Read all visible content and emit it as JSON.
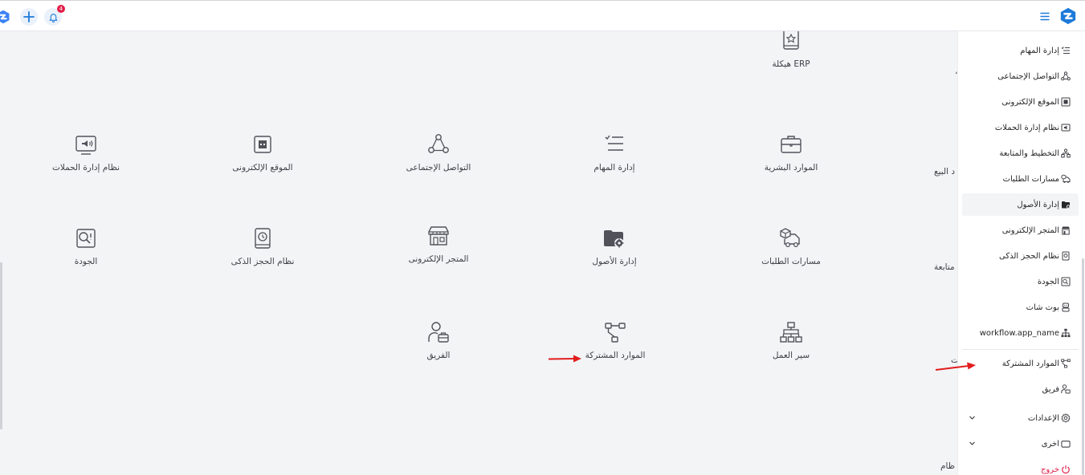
{
  "header": {
    "notifications_count": "4"
  },
  "main": {
    "top_tile": {
      "label": "هيكلة ERP"
    },
    "tiles": [
      {
        "label": "نظام إدارة الحملات",
        "icon": "megaphone-icon"
      },
      {
        "label": "الموقع الإلكترونى",
        "icon": "website-icon"
      },
      {
        "label": "التواصل الإجتماعى",
        "icon": "social-icon"
      },
      {
        "label": "إدارة المهام",
        "icon": "tasks-icon"
      },
      {
        "label": "الموارد البشرية",
        "icon": "briefcase-icon"
      },
      {
        "label": "الجودة",
        "icon": "quality-icon"
      },
      {
        "label": "نظام الحجز الذكى",
        "icon": "booking-icon"
      },
      {
        "label": "المتجر الإلكترونى",
        "icon": "store-icon"
      },
      {
        "label": "إدارة الأصول",
        "icon": "assets-icon"
      },
      {
        "label": "مسارات الطلبات",
        "icon": "delivery-icon"
      },
      {
        "label": "الفريق",
        "icon": "team-icon"
      },
      {
        "label": "الموارد المشتركة",
        "icon": "shared-icon"
      },
      {
        "label": "سير العمل",
        "icon": "workflow-icon"
      }
    ],
    "fragments": {
      "sales": "د البيع",
      "followup": "متابعة",
      "partial": "ت",
      "system": "ظام"
    }
  },
  "sidebar": {
    "items": [
      {
        "label": "إدارة المهام",
        "icon": "tasks-icon"
      },
      {
        "label": "التواصل الإجتماعى",
        "icon": "social-icon"
      },
      {
        "label": "الموقع الإلكترونى",
        "icon": "website-icon"
      },
      {
        "label": "نظام إدارة الحملات",
        "icon": "megaphone-icon"
      },
      {
        "label": "التخطيط والمتابعة",
        "icon": "planning-icon"
      },
      {
        "label": "مسارات الطلبات",
        "icon": "delivery-icon"
      },
      {
        "label": "إدارة الأصول",
        "icon": "assets-icon",
        "active": true
      },
      {
        "label": "المتجر الإلكترونى",
        "icon": "store-icon"
      },
      {
        "label": "نظام الحجز الذكى",
        "icon": "booking-icon"
      },
      {
        "label": "الجودة",
        "icon": "quality-icon"
      },
      {
        "label": "بوت شات",
        "icon": "bot-icon"
      },
      {
        "label": "workflow.app_name",
        "icon": "workflow-icon"
      }
    ],
    "shared": {
      "label": "الموارد المشتركة",
      "icon": "shared-icon"
    },
    "team": {
      "label": "فريق",
      "icon": "team-icon"
    },
    "settings": {
      "label": "الإعدادات",
      "icon": "gear-icon"
    },
    "other": {
      "label": "اخرى",
      "icon": "monitor-icon"
    },
    "logout": {
      "label": "خروج",
      "icon": "power-icon"
    }
  },
  "colors": {
    "accent": "#1d7ad9",
    "arrow": "#e11d1d",
    "logout": "#e11d48"
  }
}
